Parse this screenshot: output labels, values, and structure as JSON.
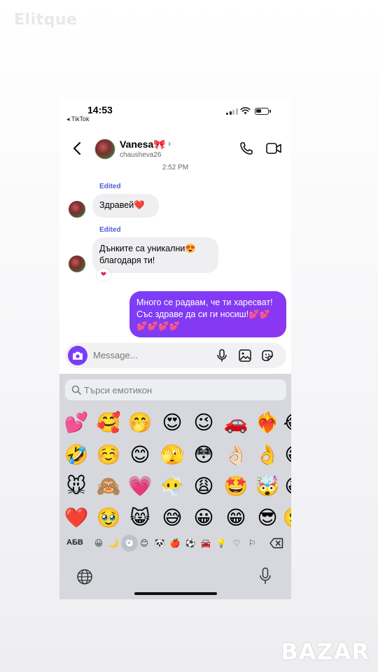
{
  "watermarks": {
    "top": "Elitque",
    "bottom": "BAZAR"
  },
  "status_bar": {
    "time": "14:53",
    "back_app": "◂ TikTok"
  },
  "header": {
    "name": "Vanesa🎀",
    "handle": "chausheva26",
    "chevron": "›"
  },
  "conversation": {
    "timestamp": "2:52 PM",
    "messages": [
      {
        "direction": "in",
        "edited_label": "Edited",
        "text": "Здравей❤️"
      },
      {
        "direction": "in",
        "edited_label": "Edited",
        "text": "Дънките са уникални😍 благодаря ти!",
        "reaction": "❤"
      },
      {
        "direction": "out",
        "text": "Много се радвам, че ти харесват! Със здраве да си ги носиш!💕💕💕💕💕💕"
      }
    ]
  },
  "composer": {
    "placeholder": "Message..."
  },
  "keyboard": {
    "search_placeholder": "Търси емотикон",
    "emoji_rows": [
      [
        "💕",
        "🥰",
        "🤭",
        "😍",
        "😉",
        "🚗",
        "❤️‍🔥",
        "😂"
      ],
      [
        "🤣",
        "☺️",
        "😊",
        "🫣",
        "😳",
        "👌🏻",
        "👌",
        "😁"
      ],
      [
        "🐭",
        "🙈",
        "💗",
        "😶‍🌫️",
        "😩",
        "🤩",
        "🤯",
        "😆"
      ],
      [
        "❤️",
        "🥹",
        "😸",
        "😅",
        "😀",
        "😁",
        "😎",
        "🙂"
      ]
    ],
    "abc_label": "АБВ",
    "categories": [
      "😀",
      "🌙",
      "🕘",
      "😊",
      "🐼",
      "🍎",
      "⚽",
      "🚘",
      "💡",
      "♡",
      "⚐"
    ],
    "active_category": "recent"
  },
  "colors": {
    "accent": "#7a3ef6",
    "edited": "#4b5fd6",
    "bubble_in": "#efeff2"
  }
}
